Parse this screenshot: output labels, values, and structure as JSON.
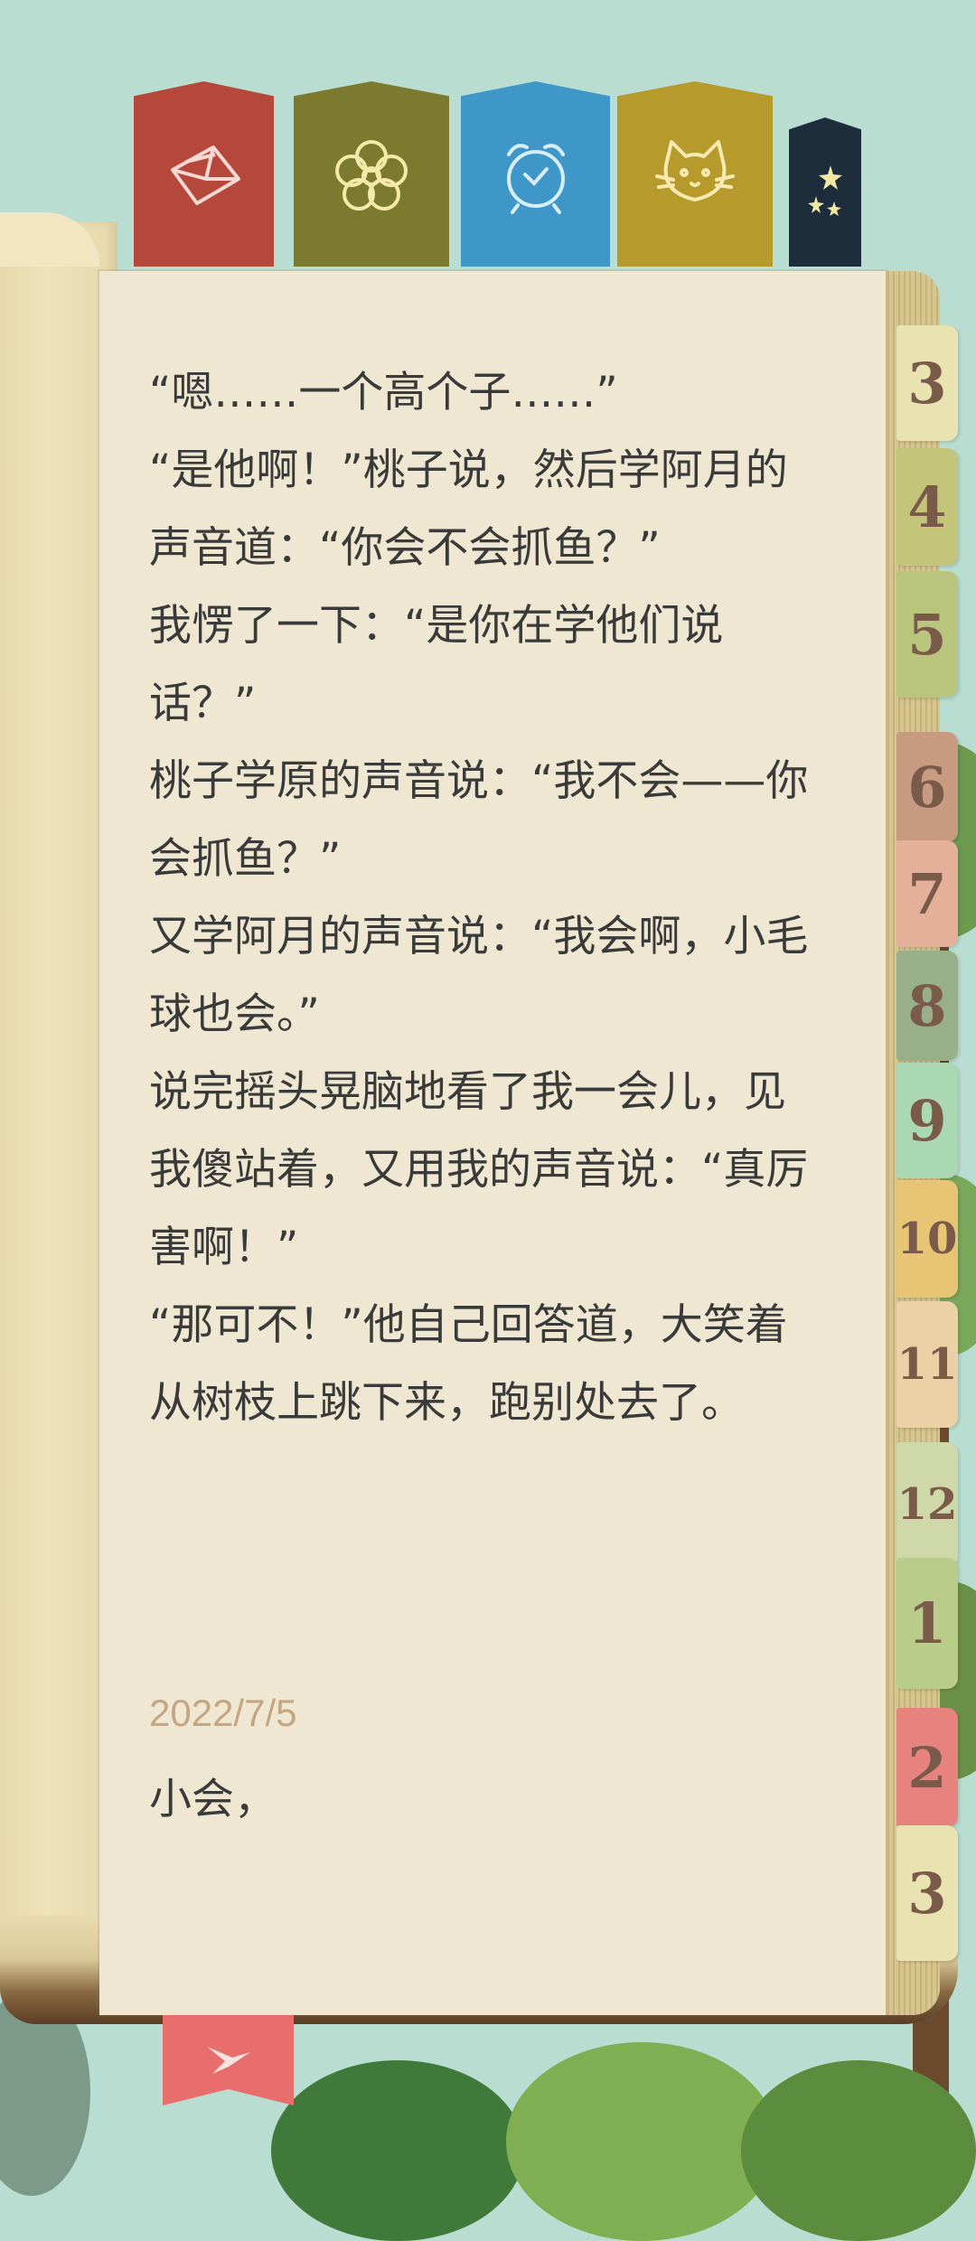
{
  "bookmarks": [
    {
      "name": "mail",
      "icon": "mail-icon",
      "color": "#b5473b"
    },
    {
      "name": "flower",
      "icon": "flower-icon",
      "color": "#7b7a2f"
    },
    {
      "name": "alarm-clock",
      "icon": "alarm-clock-icon",
      "color": "#3f97c9"
    },
    {
      "name": "cat",
      "icon": "cat-icon",
      "color": "#b69a2c"
    },
    {
      "name": "stars",
      "icon": "stars-icon",
      "color": "#1d2d3b"
    }
  ],
  "content": {
    "paragraphs": [
      "“嗯……一个高个子……”",
      "“是他啊！”桃子说，然后学阿月的声音道：“你会不会抓鱼？”",
      "我愣了一下：“是你在学他们说话？”",
      "桃子学原的声音说：“我不会——你会抓鱼？”",
      "又学阿月的声音说：“我会啊，小毛球也会。”",
      "说完摇头晃脑地看了我一会儿，见我傻站着，又用我的声音说：“真厉害啊！”",
      "“那可不！”他自己回答道，大笑着从树枝上跳下来，跑别处去了。"
    ],
    "date": "2022/7/5",
    "greeting": "小会，"
  },
  "month_tabs": [
    {
      "label": "3",
      "color": "#e9e3b2"
    },
    {
      "label": "4",
      "color": "#c2c57a"
    },
    {
      "label": "5",
      "color": "#b9c47c"
    },
    {
      "label": "6",
      "color": "#c89a82"
    },
    {
      "label": "7",
      "color": "#e5b09a"
    },
    {
      "label": "8",
      "color": "#98b08a"
    },
    {
      "label": "9",
      "color": "#a9d8b3"
    },
    {
      "label": "10",
      "color": "#e7c575"
    },
    {
      "label": "11",
      "color": "#ecd0a6"
    },
    {
      "label": "12",
      "color": "#cfd8a8"
    },
    {
      "label": "1",
      "color": "#b9cc8a"
    },
    {
      "label": "2",
      "color": "#e6837f"
    },
    {
      "label": "3",
      "color": "#e9e3b2"
    }
  ],
  "ribbon": {
    "icon": "bird-icon",
    "color": "#e76e6c"
  }
}
